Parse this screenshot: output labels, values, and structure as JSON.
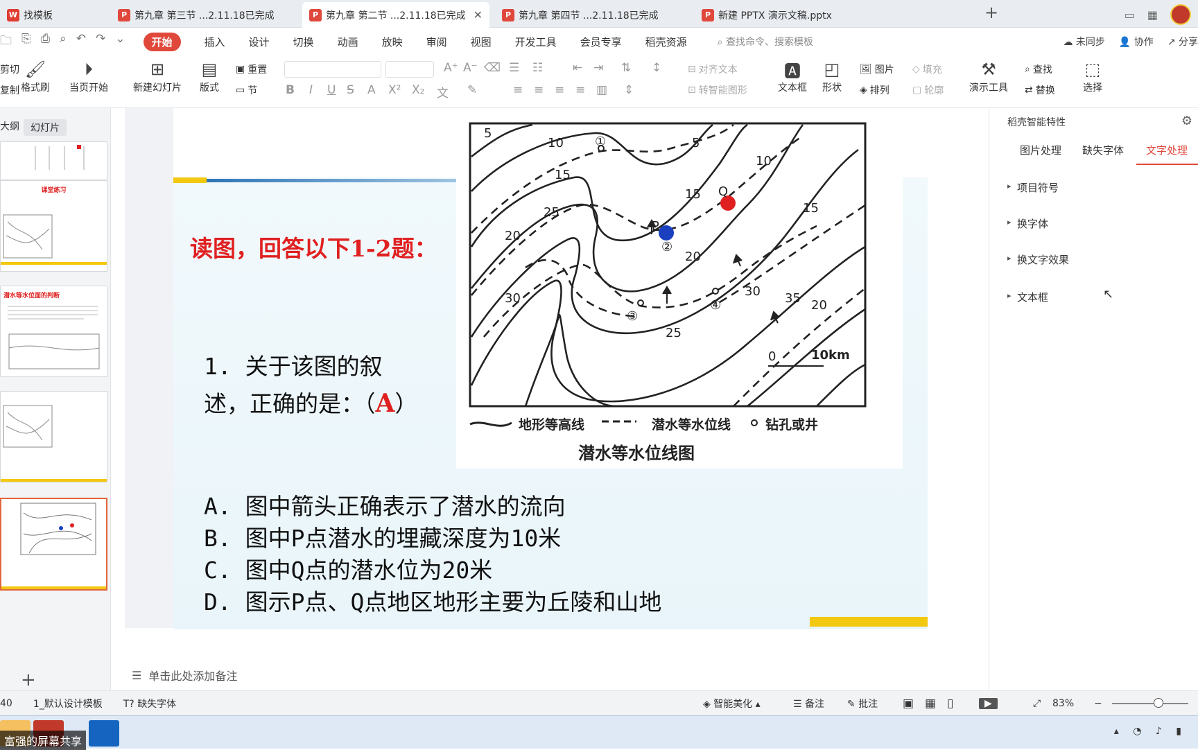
{
  "tabs": [
    {
      "label": "找模板"
    },
    {
      "label": "第九章 第三节 ...2.11.18已完成"
    },
    {
      "label": "第九章 第二节 ...2.11.18已完成"
    },
    {
      "label": "第九章 第四节 ...2.11.18已完成"
    },
    {
      "label": "新建 PPTX 演示文稿.pptx"
    }
  ],
  "menu": {
    "items": [
      "开始",
      "插入",
      "设计",
      "切换",
      "动画",
      "放映",
      "审阅",
      "视图",
      "开发工具",
      "会员专享",
      "稻壳资源"
    ],
    "search": "查找命令、搜索模板",
    "sync": "未同步",
    "collab": "协作",
    "share": "分享"
  },
  "ribbon": {
    "cut": "剪切",
    "copy": "复制",
    "format_painter": "格式刷",
    "from_current": "当页开始",
    "new_slide": "新建幻灯片",
    "layout": "版式",
    "reset": "重置",
    "section": "节",
    "align_text": "对齐文本",
    "smart_graphic": "转智能图形",
    "textbox": "文本框",
    "shape": "形状",
    "picture": "图片",
    "arrange": "排列",
    "fill": "填充",
    "outline": "轮廓",
    "demo_tools": "演示工具",
    "find": "查找",
    "replace": "替换",
    "select": "选择"
  },
  "left": {
    "outline_tab": "大纲",
    "slides_tab": "幻灯片"
  },
  "thumbs": {
    "t2_title": "课堂练习",
    "t3_title": "潜水等水位面的判断"
  },
  "slide": {
    "heading": "读图，回答以下1-2题：",
    "q1_line1": "1. 关于该图的叙",
    "q1_line2": "述，正确的是：（",
    "q1_answer": "A",
    "q1_close": "）",
    "options": [
      "A. 图中箭头正确表示了潜水的流向",
      "B. 图中P点潜水的埋藏深度为10米",
      "C. 图中Q点的潜水位为20米",
      "D. 图示P点、Q点地区地形主要为丘陵和山地"
    ],
    "map": {
      "legend_contour": "地形等高线",
      "legend_water": "潜水等水位线",
      "legend_well": "钻孔或井",
      "caption": "潜水等水位线图",
      "scale_zero": "0",
      "scale_label": "10km",
      "labels": [
        "5",
        "10",
        "15",
        "5",
        "10",
        "15",
        "20",
        "25",
        "15",
        "20",
        "30",
        "30",
        "25",
        "35",
        "20",
        "P",
        "Q",
        "①",
        "②",
        "③",
        "④"
      ]
    }
  },
  "notes": "单击此处添加备注",
  "right": {
    "title": "稻壳智能特性",
    "tabs": [
      "图片处理",
      "缺失字体",
      "文字处理"
    ],
    "items": [
      "项目符号",
      "换字体",
      "换文字效果",
      "文本框"
    ]
  },
  "status": {
    "page": "40",
    "template": "1_默认设计模板",
    "missing_font": "缺失字体",
    "beautify": "智能美化",
    "notes": "备注",
    "comments": "批注",
    "zoom": "83%"
  },
  "taskbar": {
    "share": "富强的屏幕共享"
  }
}
